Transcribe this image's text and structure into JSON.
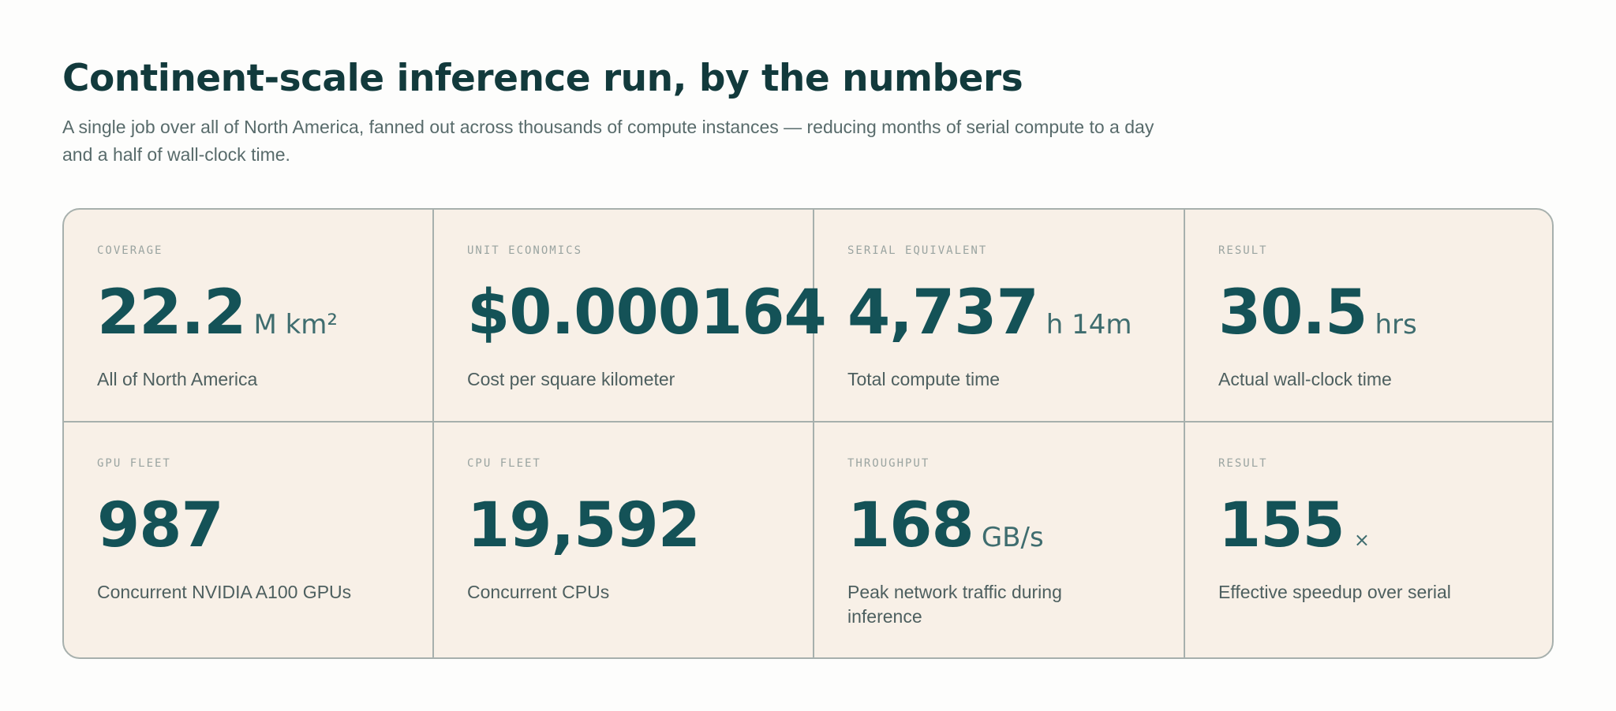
{
  "header": {
    "title": "Continent-scale inference run, by the numbers",
    "subtitle": "A single job over all of North America, fanned out across thousands of compute instances — reducing months of serial compute to a day and a half of wall-clock time."
  },
  "stats": [
    {
      "label": "COVERAGE",
      "value": "22.2",
      "unit": "M km²",
      "description": "All of North America"
    },
    {
      "label": "UNIT ECONOMICS",
      "value": "$0.000164",
      "unit": "",
      "description": "Cost per square kilometer"
    },
    {
      "label": "SERIAL EQUIVALENT",
      "value": "4,737",
      "unit": "h 14m",
      "description": "Total compute time"
    },
    {
      "label": "RESULT",
      "value": "30.5",
      "unit": "hrs",
      "description": "Actual wall-clock time"
    },
    {
      "label": "GPU FLEET",
      "value": "987",
      "unit": "",
      "description": "Concurrent NVIDIA A100 GPUs"
    },
    {
      "label": "CPU FLEET",
      "value": "19,592",
      "unit": "",
      "description": "Concurrent CPUs"
    },
    {
      "label": "THROUGHPUT",
      "value": "168",
      "unit": "GB/s",
      "description": "Peak network traffic during inference"
    },
    {
      "label": "RESULT",
      "value": "155",
      "unit": "×",
      "description": "Effective speedup over serial"
    }
  ],
  "colors": {
    "accent": "#145257",
    "card_background": "#f8f0e7",
    "border": "#a7b0ad",
    "title": "#123a3c"
  }
}
